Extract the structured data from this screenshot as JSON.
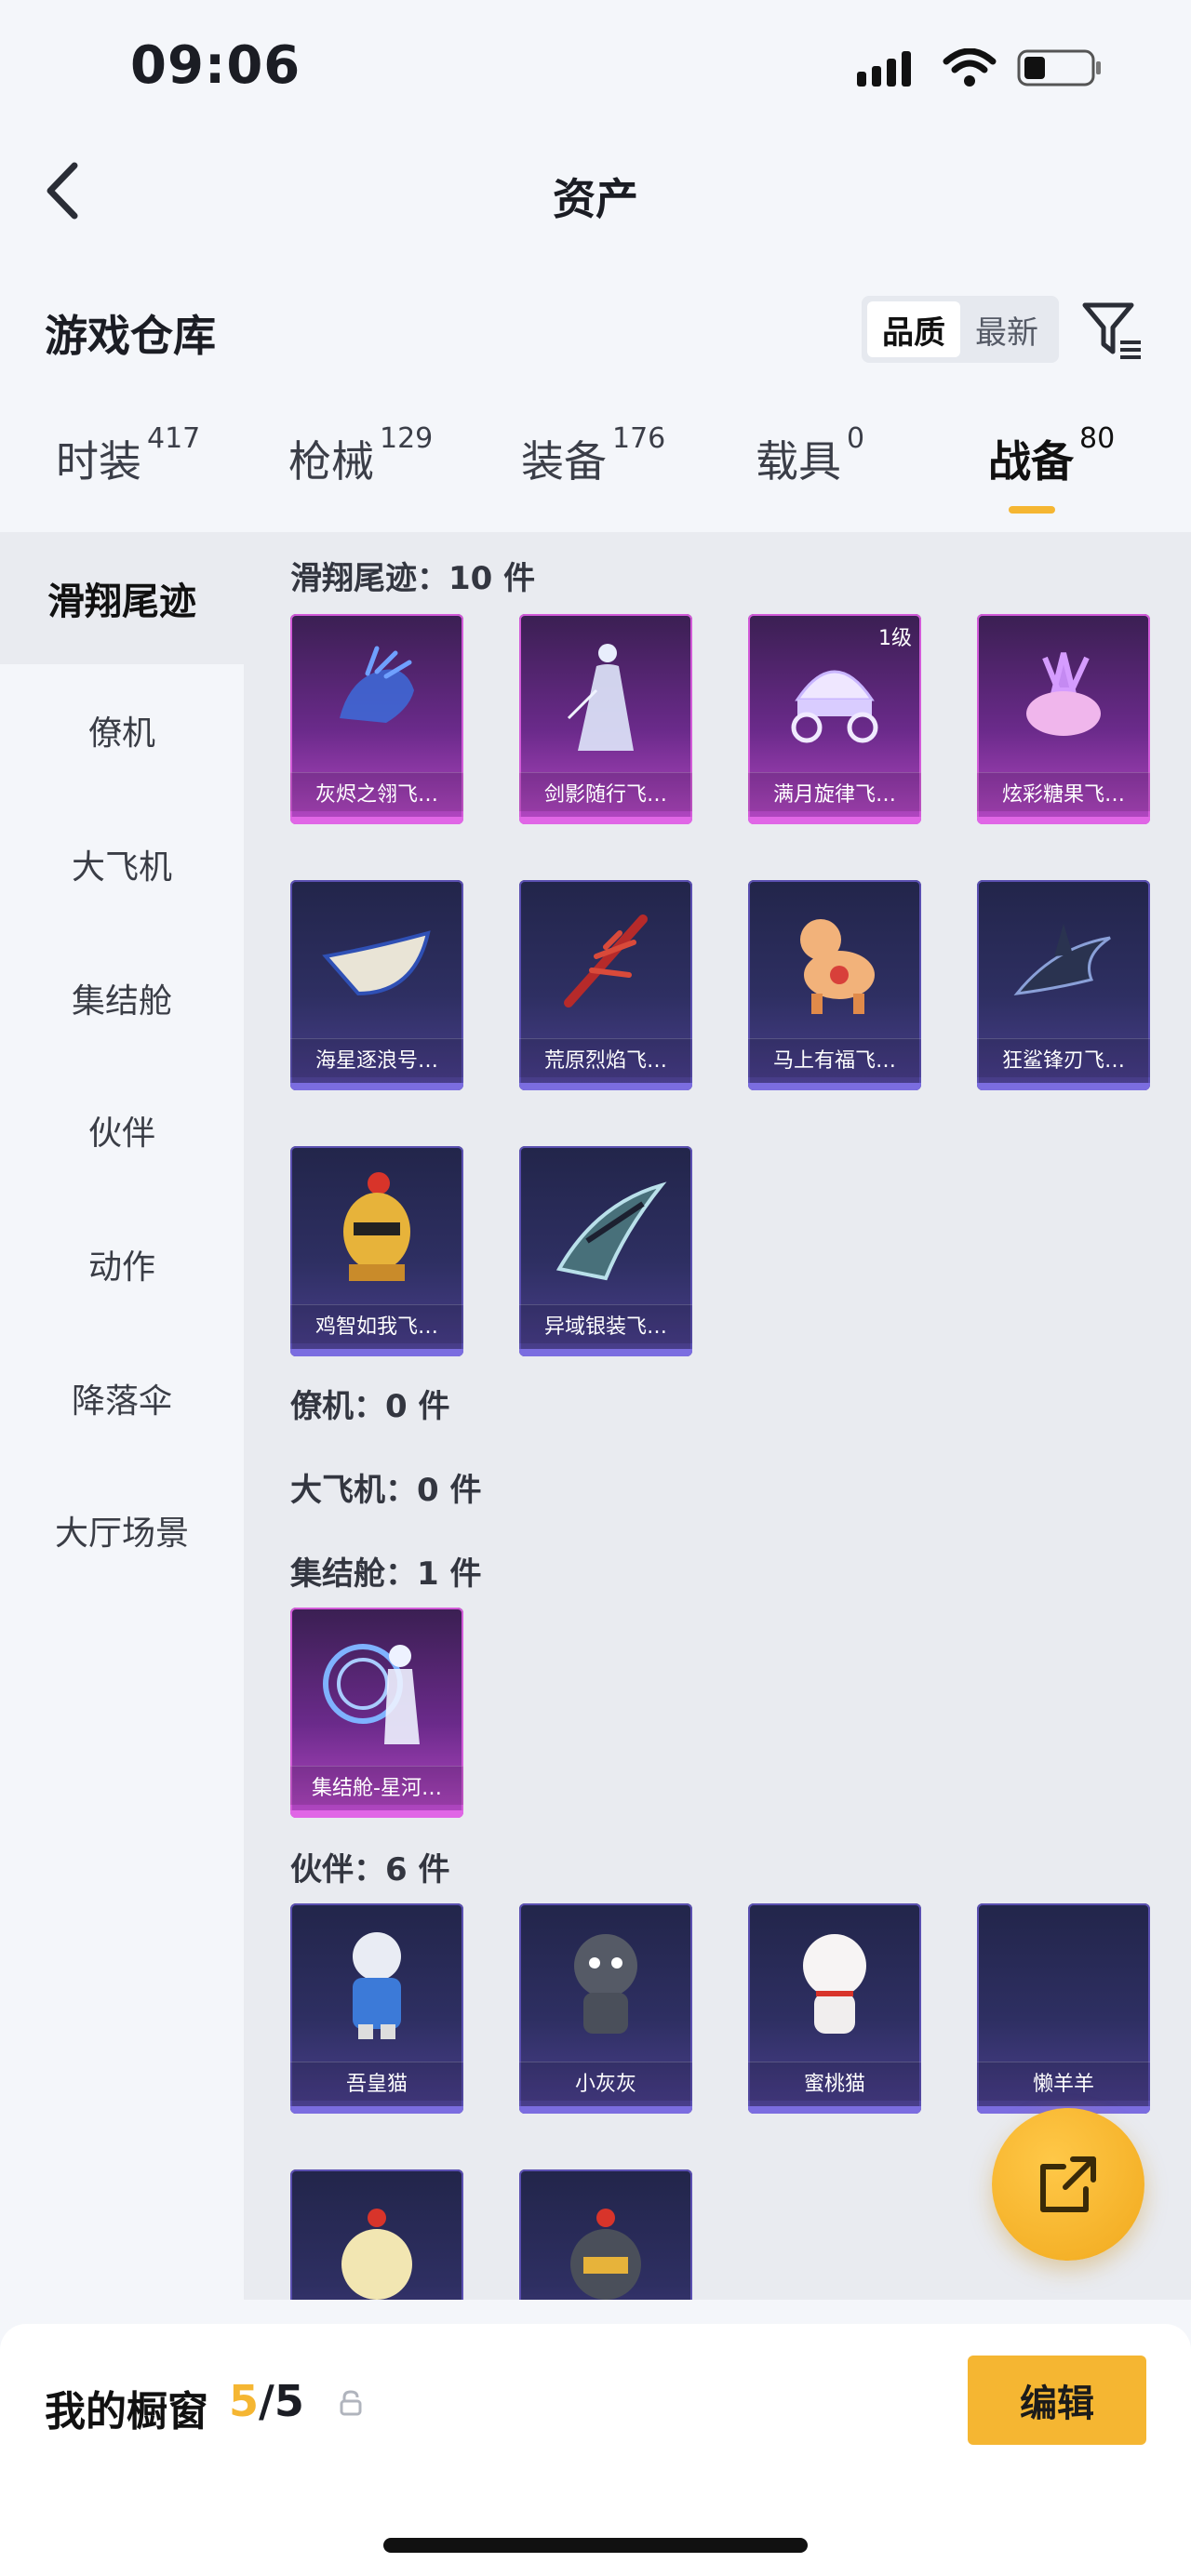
{
  "status": {
    "time": "09:06"
  },
  "nav": {
    "title": "资产"
  },
  "header": {
    "title": "游戏仓库",
    "sort_options": [
      "品质",
      "最新"
    ],
    "sort_active": "品质"
  },
  "tabs": [
    {
      "label": "时装",
      "count": "417"
    },
    {
      "label": "枪械",
      "count": "129"
    },
    {
      "label": "装备",
      "count": "176"
    },
    {
      "label": "载具",
      "count": "0"
    },
    {
      "label": "战备",
      "count": "80",
      "active": true
    }
  ],
  "sidebar": {
    "items": [
      "滑翔尾迹",
      "僚机",
      "大飞机",
      "集结舱",
      "伙伴",
      "动作",
      "降落伞",
      "大厅场景"
    ],
    "active": "滑翔尾迹"
  },
  "sections": [
    {
      "title": "滑翔尾迹：10 件",
      "items": [
        {
          "name": "灰烬之翎飞…",
          "rarity": "purple-pink"
        },
        {
          "name": "剑影随行飞…",
          "rarity": "purple-pink"
        },
        {
          "name": "满月旋律飞…",
          "rarity": "purple-pink",
          "level": "1级"
        },
        {
          "name": "炫彩糖果飞…",
          "rarity": "purple-pink"
        },
        {
          "name": "海星逐浪号…",
          "rarity": "blue-purple"
        },
        {
          "name": "荒原烈焰飞…",
          "rarity": "blue-purple"
        },
        {
          "name": "马上有福飞…",
          "rarity": "blue-purple"
        },
        {
          "name": "狂鲨锋刃飞…",
          "rarity": "blue-purple"
        },
        {
          "name": "鸡智如我飞…",
          "rarity": "blue-purple"
        },
        {
          "name": "异域银装飞…",
          "rarity": "blue-purple"
        }
      ]
    },
    {
      "title": "僚机：0 件",
      "items": []
    },
    {
      "title": "大飞机：0 件",
      "items": []
    },
    {
      "title": "集结舱：1 件",
      "items": [
        {
          "name": "集结舱-星河…",
          "rarity": "purple-pink"
        }
      ]
    },
    {
      "title": "伙伴：6 件",
      "items": [
        {
          "name": "吾皇猫",
          "rarity": "blue-purple"
        },
        {
          "name": "小灰灰",
          "rarity": "blue-purple"
        },
        {
          "name": "蜜桃猫",
          "rarity": "blue-purple"
        },
        {
          "name": "懒羊羊",
          "rarity": "blue-purple"
        },
        {
          "name": "",
          "rarity": "blue-purple"
        },
        {
          "name": "",
          "rarity": "blue-purple"
        }
      ]
    }
  ],
  "vitrine": {
    "label": "我的橱窗",
    "current": "5",
    "total": "/5",
    "edit_label": "编辑"
  },
  "colors": {
    "accent": "#f5b632",
    "card_blue": "#2e2f62",
    "card_pink": "#6a2a8a"
  }
}
